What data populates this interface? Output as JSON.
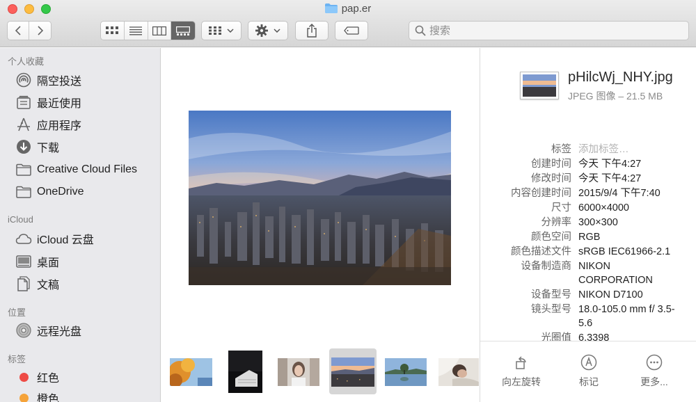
{
  "window": {
    "title": "pap.er"
  },
  "toolbar": {
    "back_icon": "chevron-left-icon",
    "forward_icon": "chevron-right-icon",
    "view_icons": [
      "icon-view-icon",
      "list-view-icon",
      "column-view-icon",
      "gallery-view-icon"
    ],
    "active_view": "gallery-view-icon",
    "search_placeholder": "搜索"
  },
  "sidebar": {
    "sections": [
      {
        "title": "个人收藏",
        "items": [
          {
            "label": "隔空投送",
            "icon": "airdrop-icon"
          },
          {
            "label": "最近使用",
            "icon": "recents-icon"
          },
          {
            "label": "应用程序",
            "icon": "applications-icon"
          },
          {
            "label": "下载",
            "icon": "downloads-icon"
          },
          {
            "label": "Creative Cloud Files",
            "icon": "folder-icon"
          },
          {
            "label": "OneDrive",
            "icon": "folder-icon"
          }
        ]
      },
      {
        "title": "iCloud",
        "items": [
          {
            "label": "iCloud 云盘",
            "icon": "cloud-icon"
          },
          {
            "label": "桌面",
            "icon": "desktop-icon"
          },
          {
            "label": "文稿",
            "icon": "documents-icon"
          }
        ]
      },
      {
        "title": "位置",
        "items": [
          {
            "label": "远程光盘",
            "icon": "remote-disc-icon"
          }
        ]
      },
      {
        "title": "标签",
        "items": [
          {
            "label": "红色",
            "color": "#ee4b45"
          },
          {
            "label": "橙色",
            "color": "#f5a33a"
          }
        ]
      }
    ]
  },
  "inspector": {
    "file_name": "pHilcWj_NHY.jpg",
    "file_meta": "JPEG 图像 – 21.5 MB",
    "properties": [
      {
        "key": "标签",
        "value": "添加标签…",
        "placeholder": true
      },
      {
        "key": "创建时间",
        "value": "今天 下午4:27"
      },
      {
        "key": "修改时间",
        "value": "今天 下午4:27"
      },
      {
        "key": "内容创建时间",
        "value": "2015/9/4 下午7:40"
      },
      {
        "key": "尺寸",
        "value": "6000×4000"
      },
      {
        "key": "分辨率",
        "value": "300×300"
      },
      {
        "key": "颜色空间",
        "value": "RGB"
      },
      {
        "key": "颜色描述文件",
        "value": "sRGB IEC61966-2.1"
      },
      {
        "key": "设备制造商",
        "value": "NIKON CORPORATION"
      },
      {
        "key": "设备型号",
        "value": "NIKON D7100"
      },
      {
        "key": "镜头型号",
        "value": "18.0-105.0 mm f/ 3.5-5.6"
      },
      {
        "key": "光圈值",
        "value": "6.3398"
      }
    ],
    "actions": [
      {
        "label": "向左旋转",
        "icon": "rotate-left-icon"
      },
      {
        "label": "标记",
        "icon": "markup-icon"
      },
      {
        "label": "更多...",
        "icon": "more-icon"
      }
    ]
  }
}
